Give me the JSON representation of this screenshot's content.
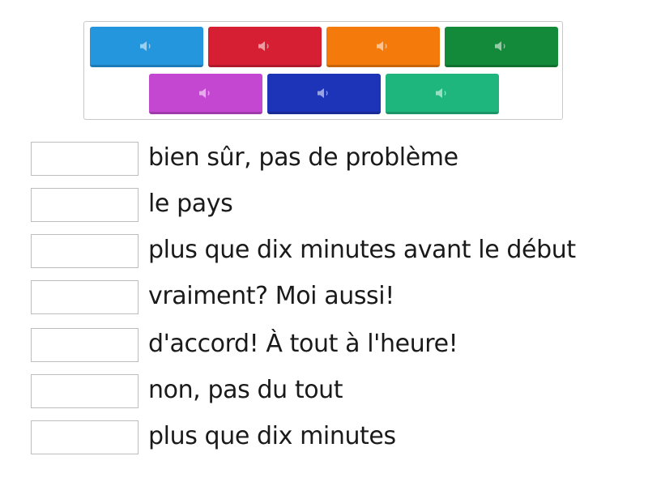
{
  "tiles": [
    {
      "icon": "speaker-icon",
      "color": "#2396de"
    },
    {
      "icon": "speaker-icon",
      "color": "#d71f33"
    },
    {
      "icon": "speaker-icon",
      "color": "#f57a0c"
    },
    {
      "icon": "speaker-icon",
      "color": "#138a3a"
    },
    {
      "icon": "speaker-icon",
      "color": "#c347d0"
    },
    {
      "icon": "speaker-icon",
      "color": "#1d34b8"
    },
    {
      "icon": "speaker-icon",
      "color": "#1fb67e"
    }
  ],
  "items": [
    {
      "text": "bien sûr, pas de problème",
      "answer": ""
    },
    {
      "text": "le pays",
      "answer": ""
    },
    {
      "text": "plus que dix minutes avant le début",
      "answer": ""
    },
    {
      "text": "vraiment? Moi aussi!",
      "answer": ""
    },
    {
      "text": "d'accord! À tout à l'heure!",
      "answer": ""
    },
    {
      "text": "non, pas du tout",
      "answer": ""
    },
    {
      "text": "plus que dix minutes",
      "answer": ""
    }
  ]
}
